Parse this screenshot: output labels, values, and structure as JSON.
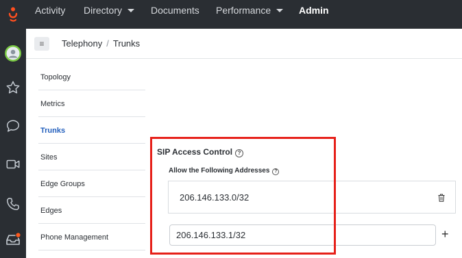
{
  "topnav": {
    "items": [
      {
        "label": "Activity",
        "has_caret": false
      },
      {
        "label": "Directory",
        "has_caret": true
      },
      {
        "label": "Documents",
        "has_caret": false
      },
      {
        "label": "Performance",
        "has_caret": true
      },
      {
        "label": "Admin",
        "has_caret": false,
        "active": true
      }
    ]
  },
  "rail": {
    "icons": [
      "avatar-icon",
      "star-icon",
      "chat-icon",
      "video-icon",
      "phone-icon",
      "inbox-icon"
    ],
    "notification_color": "#ff5a1f"
  },
  "header": {
    "menu_glyph": "≡",
    "breadcrumb": [
      "Telephony",
      "Trunks"
    ],
    "separator": "/"
  },
  "sidemenu": {
    "items": [
      {
        "label": "Topology"
      },
      {
        "label": "Metrics"
      },
      {
        "label": "Trunks",
        "active": true
      },
      {
        "label": "Sites"
      },
      {
        "label": "Edge Groups"
      },
      {
        "label": "Edges"
      },
      {
        "label": "Phone Management"
      }
    ]
  },
  "sip": {
    "title": "SIP Access Control",
    "allow_label": "Allow the Following Addresses",
    "help_glyph": "?",
    "addresses": [
      "206.146.133.0/32"
    ],
    "new_address_value": "206.146.133.1/32",
    "add_glyph": "+"
  },
  "colors": {
    "nav_bg": "#2a2e33",
    "active_link": "#2460bd",
    "highlight": "#e62019",
    "logo": "#ff4f1f",
    "avatar_ring": "#7ac943"
  }
}
